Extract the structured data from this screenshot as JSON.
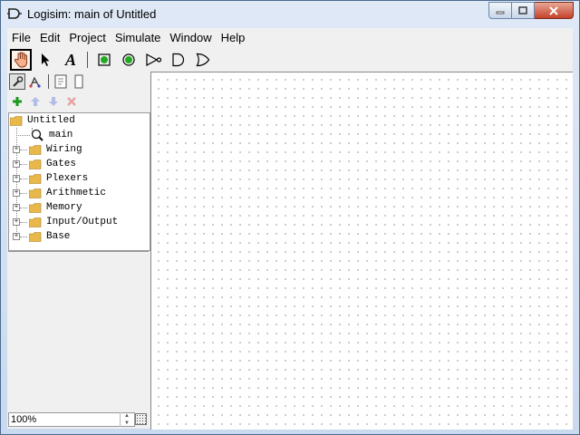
{
  "window": {
    "title": "Logisim: main of Untitled"
  },
  "menu": {
    "items": [
      {
        "label": "File"
      },
      {
        "label": "Edit"
      },
      {
        "label": "Project"
      },
      {
        "label": "Simulate"
      },
      {
        "label": "Window"
      },
      {
        "label": "Help"
      }
    ]
  },
  "toolbar": {
    "tools": [
      {
        "name": "poke-tool",
        "icon": "hand-icon",
        "selected": true
      },
      {
        "name": "select-tool",
        "icon": "arrow-icon"
      },
      {
        "name": "text-tool",
        "icon": "text-a-icon",
        "glyph": "A"
      },
      {
        "name": "input-pin",
        "icon": "input-pin-icon"
      },
      {
        "name": "output-pin",
        "icon": "output-pin-icon"
      },
      {
        "name": "not-gate",
        "icon": "not-gate-icon"
      },
      {
        "name": "and-gate",
        "icon": "and-gate-icon"
      },
      {
        "name": "or-gate",
        "icon": "or-gate-icon"
      }
    ]
  },
  "tree": {
    "project": "Untitled",
    "circuit": "main",
    "libraries": [
      {
        "label": "Wiring"
      },
      {
        "label": "Gates"
      },
      {
        "label": "Plexers"
      },
      {
        "label": "Arithmetic"
      },
      {
        "label": "Memory"
      },
      {
        "label": "Input/Output"
      },
      {
        "label": "Base"
      }
    ]
  },
  "zoom": {
    "value": "100%"
  },
  "colors": {
    "canvas_dot": "#555555",
    "folder": "#e8b94a",
    "add_green": "#1a9a1a",
    "pin_green": "#22aa22"
  }
}
